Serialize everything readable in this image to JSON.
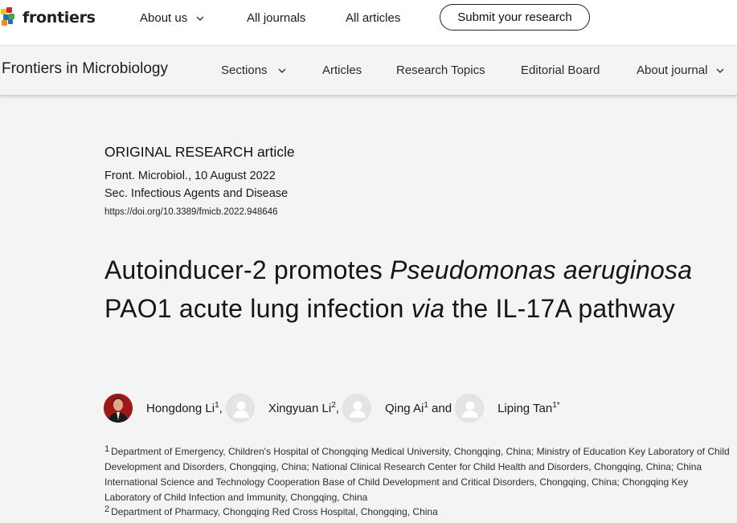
{
  "brand": {
    "name": "frontiers"
  },
  "topnav": {
    "items": [
      "About us",
      "All journals",
      "All articles"
    ],
    "submit_label": "Submit your research"
  },
  "journal_nav": {
    "title": "Frontiers in Microbiology",
    "items": [
      "Sections",
      "Articles",
      "Research Topics",
      "Editorial Board",
      "About journal"
    ]
  },
  "article": {
    "type": "ORIGINAL RESEARCH article",
    "citation": "Front. Microbiol., 10 August 2022",
    "section": "Sec. Infectious Agents and Disease",
    "doi": "https://doi.org/10.3389/fmicb.2022.948646",
    "title_parts": {
      "p1": "Autoinducer-2 promotes ",
      "p2": "Pseudomonas aeruginosa",
      "p3": " PAO1 acute lung infection ",
      "p4": "via",
      "p5": " the IL-17A pathway"
    },
    "authors": [
      {
        "name": "Hongdong Li",
        "sup": "1",
        "sep": ","
      },
      {
        "name": "Xingyuan Li",
        "sup": "2",
        "sep": ","
      },
      {
        "name": "Qing Ai",
        "sup": "1",
        "sep": " and"
      },
      {
        "name": "Liping Tan",
        "sup": "1*",
        "sep": ""
      }
    ],
    "affiliations": [
      {
        "num": "1",
        "text": "Department of Emergency, Children's Hospital of Chongqing Medical University, Chongqing, China; Ministry of Education Key Laboratory of Child Development and Disorders, Chongqing, China; National Clinical Research Center for Child Health and Disorders, Chongqing, China; China International Science and Technology Cooperation Base of Child Development and Critical Disorders, Chongqing, China; Chongqing Key Laboratory of Child Infection and Immunity, Chongqing, China"
      },
      {
        "num": "2",
        "text": "Department of Pharmacy, Chongqing Red Cross Hospital, Chongqing, China"
      }
    ]
  },
  "colors": {
    "logo_blue": "#1d73b8",
    "logo_orange": "#f08d1b",
    "logo_red": "#d2262a",
    "logo_green": "#4aa54a",
    "logo_yellow": "#f5c013",
    "page_background": "#f4f4f4"
  }
}
